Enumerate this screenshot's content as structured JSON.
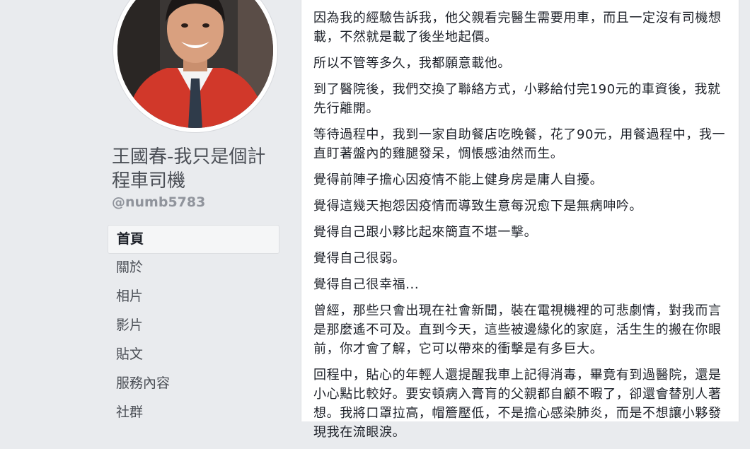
{
  "sidebar": {
    "page_name": "王國春-我只是個計程車司機",
    "handle": "@numb5783",
    "nav": [
      {
        "label": "首頁",
        "active": true
      },
      {
        "label": "關於",
        "active": false
      },
      {
        "label": "相片",
        "active": false
      },
      {
        "label": "影片",
        "active": false
      },
      {
        "label": "貼文",
        "active": false
      },
      {
        "label": "服務內容",
        "active": false
      },
      {
        "label": "社群",
        "active": false
      }
    ]
  },
  "post": {
    "paragraphs": [
      "因為我的經驗告訴我，他父親看完醫生需要用車，而且一定沒有司機想載，不然就是載了後坐地起價。",
      "所以不管等多久，我都願意載他。",
      "到了醫院後，我們交換了聯絡方式，小夥給付完190元的車資後，我就先行離開。",
      "等待過程中，我到一家自助餐店吃晚餐，花了90元，用餐過程中，我一直盯著盤內的雞腿發呆，惆悵感油然而生。",
      "覺得前陣子擔心因疫情不能上健身房是庸人自擾。",
      "覺得這幾天抱怨因疫情而導致生意每況愈下是無病呻吟。",
      "覺得自己跟小夥比起來簡直不堪一擊。",
      "覺得自己很弱。",
      "覺得自己很幸福...",
      "曾經，那些只會出現在社會新聞，裝在電視機裡的可悲劇情，對我而言是那麼遙不可及。直到今天，這些被邊緣化的家庭，活生生的搬在你眼前，你才會了解，它可以帶來的衝擊是有多巨大。",
      "回程中，貼心的年輕人還提醒我車上記得消毒，畢竟有到過醫院，還是小心點比較好。要安頓病入膏肓的父親都自顧不暇了，卻還會替別人著想。我將口罩拉高，帽簷壓低，不是擔心感染肺炎，而是不想讓小夥發現我在流眼淚。"
    ]
  },
  "colors": {
    "background": "#e9ebee",
    "card": "#ffffff",
    "text": "#1d2129",
    "muted": "#90949c"
  }
}
